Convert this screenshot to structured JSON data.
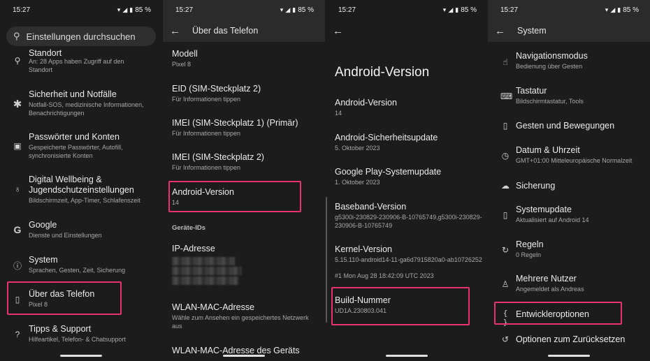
{
  "status": {
    "time": "15:27",
    "battery": "85 %"
  },
  "panel1": {
    "search_placeholder": "Einstellungen durchsuchen",
    "items": [
      {
        "title": "Standort",
        "sub": "An: 28 Apps haben Zugriff auf den Standort"
      },
      {
        "title": "Sicherheit und Notfälle",
        "sub": "Notfall-SOS, medizinische Informationen, Benachrichtigungen"
      },
      {
        "title": "Passwörter und Konten",
        "sub": "Gespeicherte Passwörter, Autofill, synchronisierte Konten"
      },
      {
        "title": "Digital Wellbeing &",
        "title2": "Jugendschutzeinstellungen",
        "sub": "Bildschirmzeit, App-Timer, Schlafenszeit"
      },
      {
        "title": "Google",
        "sub": "Dienste und Einstellungen"
      },
      {
        "title": "System",
        "sub": "Sprachen, Gesten, Zeit, Sicherung"
      },
      {
        "title": "Über das Telefon",
        "sub": "Pixel 8"
      },
      {
        "title": "Tipps & Support",
        "sub": "Hilfeartikel, Telefon- & Chatsupport"
      }
    ]
  },
  "panel2": {
    "title": "Über das Telefon",
    "items": [
      {
        "title": "Modell",
        "sub": "Pixel 8"
      },
      {
        "title": "EID (SIM-Steckplatz 2)",
        "sub": "Für Informationen tippen"
      },
      {
        "title": "IMEI (SIM-Steckplatz 1) (Primär)",
        "sub": "Für Informationen tippen"
      },
      {
        "title": "IMEI (SIM-Steckplatz 2)",
        "sub": "Für Informationen tippen"
      },
      {
        "title": "Android-Version",
        "sub": "14"
      }
    ],
    "section": "Geräte-IDs",
    "ip_title": "IP-Adresse",
    "wlan_title": "WLAN-MAC-Adresse",
    "wlan_sub": "Wähle zum Ansehen ein gespeichertes Netzwerk aus",
    "wlan_device_title": "WLAN-MAC-Adresse des Geräts"
  },
  "panel3": {
    "heading": "Android-Version",
    "items": [
      {
        "title": "Android-Version",
        "sub": "14"
      },
      {
        "title": "Android-Sicherheitsupdate",
        "sub": "5. Oktober 2023"
      },
      {
        "title": "Google Play-Systemupdate",
        "sub": "1. Oktober 2023"
      },
      {
        "title": "Baseband-Version",
        "sub": "g5300i-230829-230906-B-10765749,g5300i-230829-230906-B-10765749"
      },
      {
        "title": "Kernel-Version",
        "sub": "5.15.110-android14-11-ga6d7915820a0-ab10726252",
        "sub2": "#1 Mon Aug 28 18:42:09 UTC 2023"
      },
      {
        "title": "Build-Nummer",
        "sub": "UD1A.230803.041"
      }
    ]
  },
  "panel4": {
    "title": "System",
    "items": [
      {
        "icon": "navigation-mode-icon",
        "title": "Navigationsmodus",
        "sub": "Bedienung über Gesten"
      },
      {
        "icon": "keyboard-icon",
        "title": "Tastatur",
        "sub": "Bildschirmtastatur, Tools"
      },
      {
        "icon": "gestures-icon",
        "title": "Gesten und Bewegungen",
        "sub": ""
      },
      {
        "icon": "clock-icon",
        "title": "Datum & Uhrzeit",
        "sub": "GMT+01:00 Mitteleuropäische Normalzeit"
      },
      {
        "icon": "backup-cloud-icon",
        "title": "Sicherung",
        "sub": ""
      },
      {
        "icon": "system-update-icon",
        "title": "Systemupdate",
        "sub": "Aktualisiert auf Android 14"
      },
      {
        "icon": "rules-icon",
        "title": "Regeln",
        "sub": "0 Regeln"
      },
      {
        "icon": "multiple-users-icon",
        "title": "Mehrere Nutzer",
        "sub": "Angemeldet als Andreas"
      },
      {
        "icon": "developer-options-icon",
        "title": "Entwickleroptionen",
        "sub": ""
      },
      {
        "icon": "reset-options-icon",
        "title": "Optionen zum Zurücksetzen",
        "sub": ""
      }
    ]
  },
  "colors": {
    "highlight": "#e8336f",
    "background": "#1c1c1c"
  }
}
